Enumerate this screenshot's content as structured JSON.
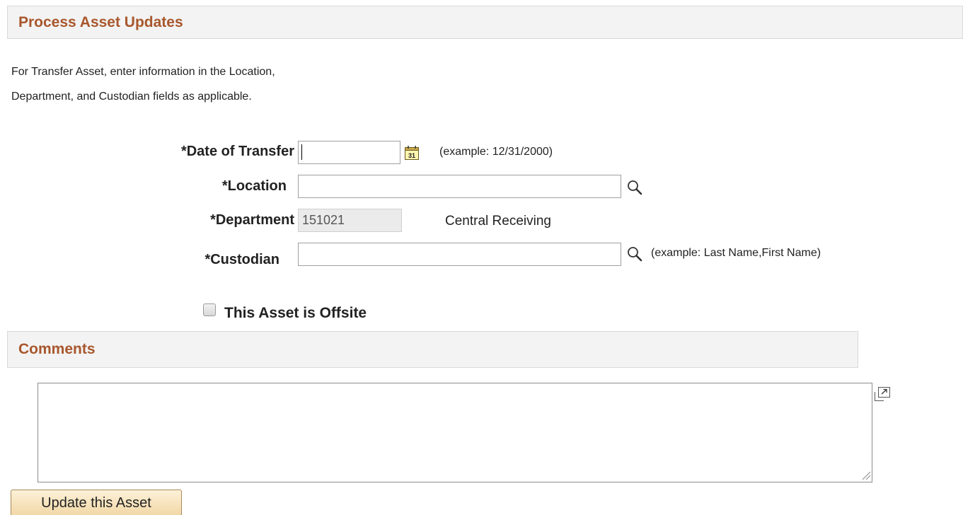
{
  "header": {
    "title": "Process Asset Updates"
  },
  "instructions": {
    "line1": "For Transfer Asset, enter information in the Location,",
    "line2": "Department, and Custodian fields as applicable."
  },
  "form": {
    "date_of_transfer": {
      "label": "*Date of Transfer",
      "value": "",
      "hint": "(example: 12/31/2000)",
      "icon": "calendar-icon",
      "icon_text": "31"
    },
    "location": {
      "label": "*Location",
      "value": "",
      "icon": "lookup-magnifier-icon"
    },
    "department": {
      "label": "*Department",
      "value": "151021",
      "description": "Central Receiving"
    },
    "custodian": {
      "label": "*Custodian",
      "value": "",
      "hint": "(example: Last Name,First Name)",
      "icon": "lookup-magnifier-icon"
    },
    "offsite": {
      "label": "This Asset is Offsite",
      "checked": false
    }
  },
  "comments": {
    "title": "Comments",
    "value": "",
    "expand_icon": "expand-textarea-icon"
  },
  "actions": {
    "update_label": "Update this Asset"
  },
  "colors": {
    "section_title": "#a8572c",
    "section_bg": "#f3f3f3",
    "button_bg": "#f2d8a7"
  }
}
